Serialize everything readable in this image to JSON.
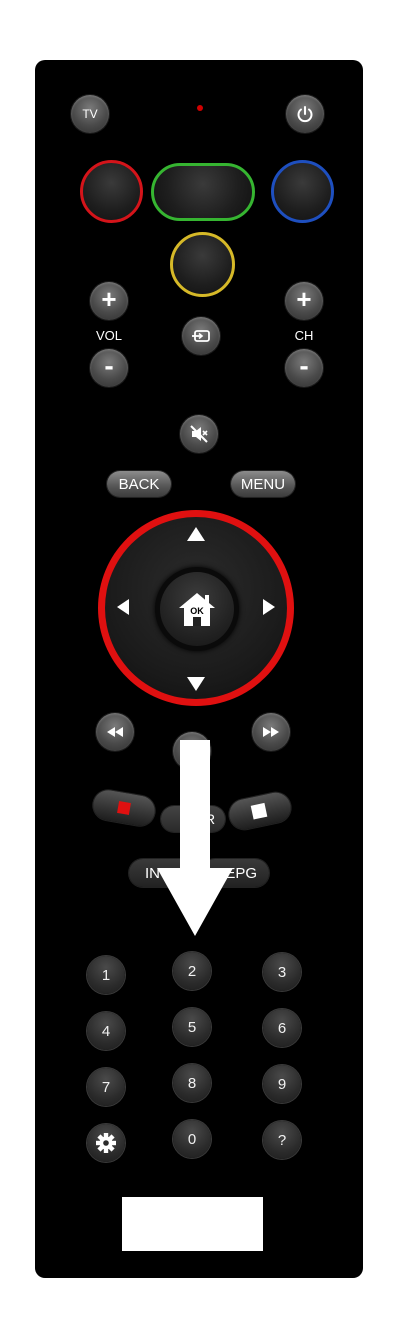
{
  "remote": {
    "tv_label": "TV",
    "vol_label": "VOL",
    "ch_label": "CH",
    "plus": "+",
    "minus": "-",
    "back_label": "BACK",
    "menu_label": "MENU",
    "ok_label": "OK",
    "info_label": "IN",
    "epg_label": "EPG",
    "partial_label": "R",
    "numbers": [
      "1",
      "2",
      "3",
      "4",
      "5",
      "6",
      "7",
      "8",
      "9",
      "0"
    ],
    "help_label": "?",
    "colors": {
      "red": "#d4141a",
      "green": "#36b531",
      "blue": "#1e4fbf",
      "yellow": "#d6b928",
      "dpad_ring": "#e01010",
      "led": "#d00000"
    },
    "icons": [
      "power-icon",
      "input-source-icon",
      "mute-icon",
      "home-icon",
      "arrow-up-icon",
      "arrow-down-icon",
      "arrow-left-icon",
      "arrow-right-icon",
      "rewind-icon",
      "fast-forward-icon",
      "record-icon",
      "stop-icon",
      "settings-gear-icon"
    ]
  }
}
